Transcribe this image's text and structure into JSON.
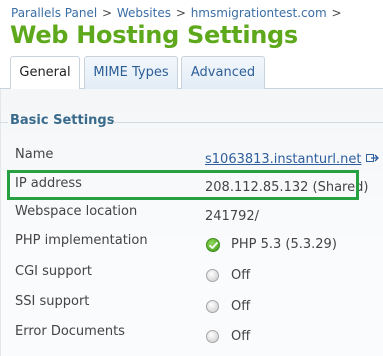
{
  "breadcrumb": {
    "items": [
      "Parallels Panel",
      "Websites",
      "hmsmigrationtest.com"
    ],
    "separator": ">"
  },
  "page_title": "Web Hosting Settings",
  "tabs": [
    {
      "label": "General",
      "active": true
    },
    {
      "label": "MIME Types",
      "active": false
    },
    {
      "label": "Advanced",
      "active": false
    }
  ],
  "section": {
    "title": "Basic Settings"
  },
  "rows": {
    "name": {
      "label": "Name",
      "value": "s1063813.instanturl.net",
      "icon": "external-link-icon"
    },
    "ip": {
      "label": "IP address",
      "value": "208.112.85.132 (Shared)"
    },
    "webspace": {
      "label": "Webspace location",
      "value": "241792/"
    },
    "php": {
      "label": "PHP implementation",
      "value": "PHP 5.3 (5.3.29)",
      "icon": "check-ok-icon"
    },
    "cgi": {
      "label": "CGI support",
      "value": "Off",
      "icon": "radio-off-icon"
    },
    "ssi": {
      "label": "SSI support",
      "value": "Off",
      "icon": "radio-off-icon"
    },
    "errordocs": {
      "label": "Error Documents",
      "value": "Off",
      "icon": "radio-off-icon"
    }
  },
  "colors": {
    "title_green": "#5ea81c",
    "highlight_green": "#27a042",
    "link_blue": "#2f5f9e",
    "section_blue": "#3a6b8c"
  }
}
